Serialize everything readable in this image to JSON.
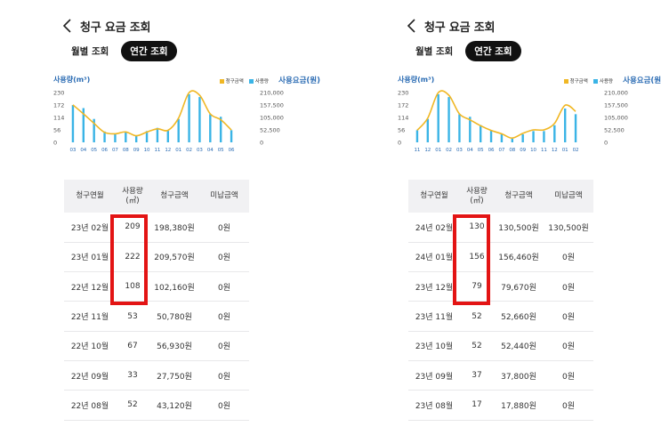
{
  "colors": {
    "bar": "#3ab4e6",
    "line": "#f0b724",
    "axis_text": "#2a6bb3",
    "tick_text": "#555555",
    "highlight": "#e31414"
  },
  "panels": [
    {
      "title": "청구 요금 조회",
      "tabs": [
        {
          "label": "월별 조회",
          "active": false
        },
        {
          "label": "연간 조회",
          "active": true
        }
      ],
      "chart": {
        "usage_label": "사용량(m³)",
        "bill_label": "사용요금(원)",
        "legend": [
          "청구금액",
          "사용량"
        ],
        "y_left_ticks": [
          "230",
          "172",
          "114",
          "56",
          "0"
        ],
        "y_right_ticks": [
          "210,000",
          "157,500",
          "105,000",
          "52,500",
          "0"
        ]
      },
      "table": {
        "headers": [
          "청구연월",
          "사용량(㎥)",
          "청구금액",
          "미납금액"
        ],
        "rows": [
          {
            "month": "23년 02월",
            "usage": "209",
            "billed": "198,380원",
            "unpaid": "0원"
          },
          {
            "month": "23년 01월",
            "usage": "222",
            "billed": "209,570원",
            "unpaid": "0원"
          },
          {
            "month": "22년 12월",
            "usage": "108",
            "billed": "102,160원",
            "unpaid": "0원"
          },
          {
            "month": "22년 11월",
            "usage": "53",
            "billed": "50,780원",
            "unpaid": "0원"
          },
          {
            "month": "22년 10월",
            "usage": "67",
            "billed": "56,930원",
            "unpaid": "0원"
          },
          {
            "month": "22년 09월",
            "usage": "33",
            "billed": "27,750원",
            "unpaid": "0원"
          },
          {
            "month": "22년 08월",
            "usage": "52",
            "billed": "43,120원",
            "unpaid": "0원"
          }
        ]
      }
    },
    {
      "title": "청구 요금 조회",
      "tabs": [
        {
          "label": "월별 조회",
          "active": false
        },
        {
          "label": "연간 조회",
          "active": true
        }
      ],
      "chart": {
        "usage_label": "사용량(m³)",
        "bill_label": "사용요금(원)",
        "legend": [
          "청구금액",
          "사용량"
        ],
        "y_left_ticks": [
          "230",
          "172",
          "114",
          "56",
          "0"
        ],
        "y_right_ticks": [
          "210,000",
          "157,500",
          "105,000",
          "52,500",
          "0"
        ]
      },
      "table": {
        "headers": [
          "청구연월",
          "사용량(㎥)",
          "청구금액",
          "미납금액"
        ],
        "rows": [
          {
            "month": "24년 02월",
            "usage": "130",
            "billed": "130,500원",
            "unpaid": "130,500원"
          },
          {
            "month": "24년 01월",
            "usage": "156",
            "billed": "156,460원",
            "unpaid": "0원"
          },
          {
            "month": "23년 12월",
            "usage": "79",
            "billed": "79,670원",
            "unpaid": "0원"
          },
          {
            "month": "23년 11월",
            "usage": "52",
            "billed": "52,660원",
            "unpaid": "0원"
          },
          {
            "month": "23년 10월",
            "usage": "52",
            "billed": "52,440원",
            "unpaid": "0원"
          },
          {
            "month": "23년 09월",
            "usage": "37",
            "billed": "37,800원",
            "unpaid": "0원"
          },
          {
            "month": "23년 08월",
            "usage": "17",
            "billed": "17,880원",
            "unpaid": "0원"
          }
        ]
      }
    }
  ],
  "chart_data": [
    {
      "type": "bar",
      "categories": [
        "03",
        "04",
        "05",
        "06",
        "07",
        "08",
        "09",
        "10",
        "11",
        "12",
        "01",
        "02",
        "03",
        "04",
        "05",
        "06"
      ],
      "series": [
        {
          "name": "사용량",
          "values": [
            172,
            158,
            108,
            50,
            40,
            48,
            33,
            52,
            67,
            53,
            108,
            222,
            209,
            130,
            118,
            56
          ]
        },
        {
          "name": "청구금액",
          "values": [
            158000,
            120000,
            80000,
            42000,
            36000,
            44000,
            27750,
            43120,
            56930,
            50780,
            102160,
            209570,
            198380,
            120000,
            95000,
            52000
          ]
        }
      ],
      "ylim_left": [
        0,
        230
      ],
      "ylim_right": [
        0,
        210000
      ]
    },
    {
      "type": "bar",
      "categories": [
        "11",
        "12",
        "01",
        "02",
        "03",
        "04",
        "05",
        "06",
        "07",
        "08",
        "09",
        "10",
        "11",
        "12",
        "01",
        "02"
      ],
      "series": [
        {
          "name": "사용량",
          "values": [
            56,
            108,
            222,
            209,
            130,
            118,
            80,
            56,
            40,
            17,
            37,
            52,
            52,
            79,
            156,
            130
          ]
        },
        {
          "name": "청구금액",
          "values": [
            50780,
            102160,
            209570,
            198380,
            120000,
            95000,
            70000,
            50000,
            36000,
            17880,
            37800,
            52440,
            52660,
            79670,
            156460,
            130500
          ]
        }
      ],
      "ylim_left": [
        0,
        230
      ],
      "ylim_right": [
        0,
        210000
      ]
    }
  ]
}
